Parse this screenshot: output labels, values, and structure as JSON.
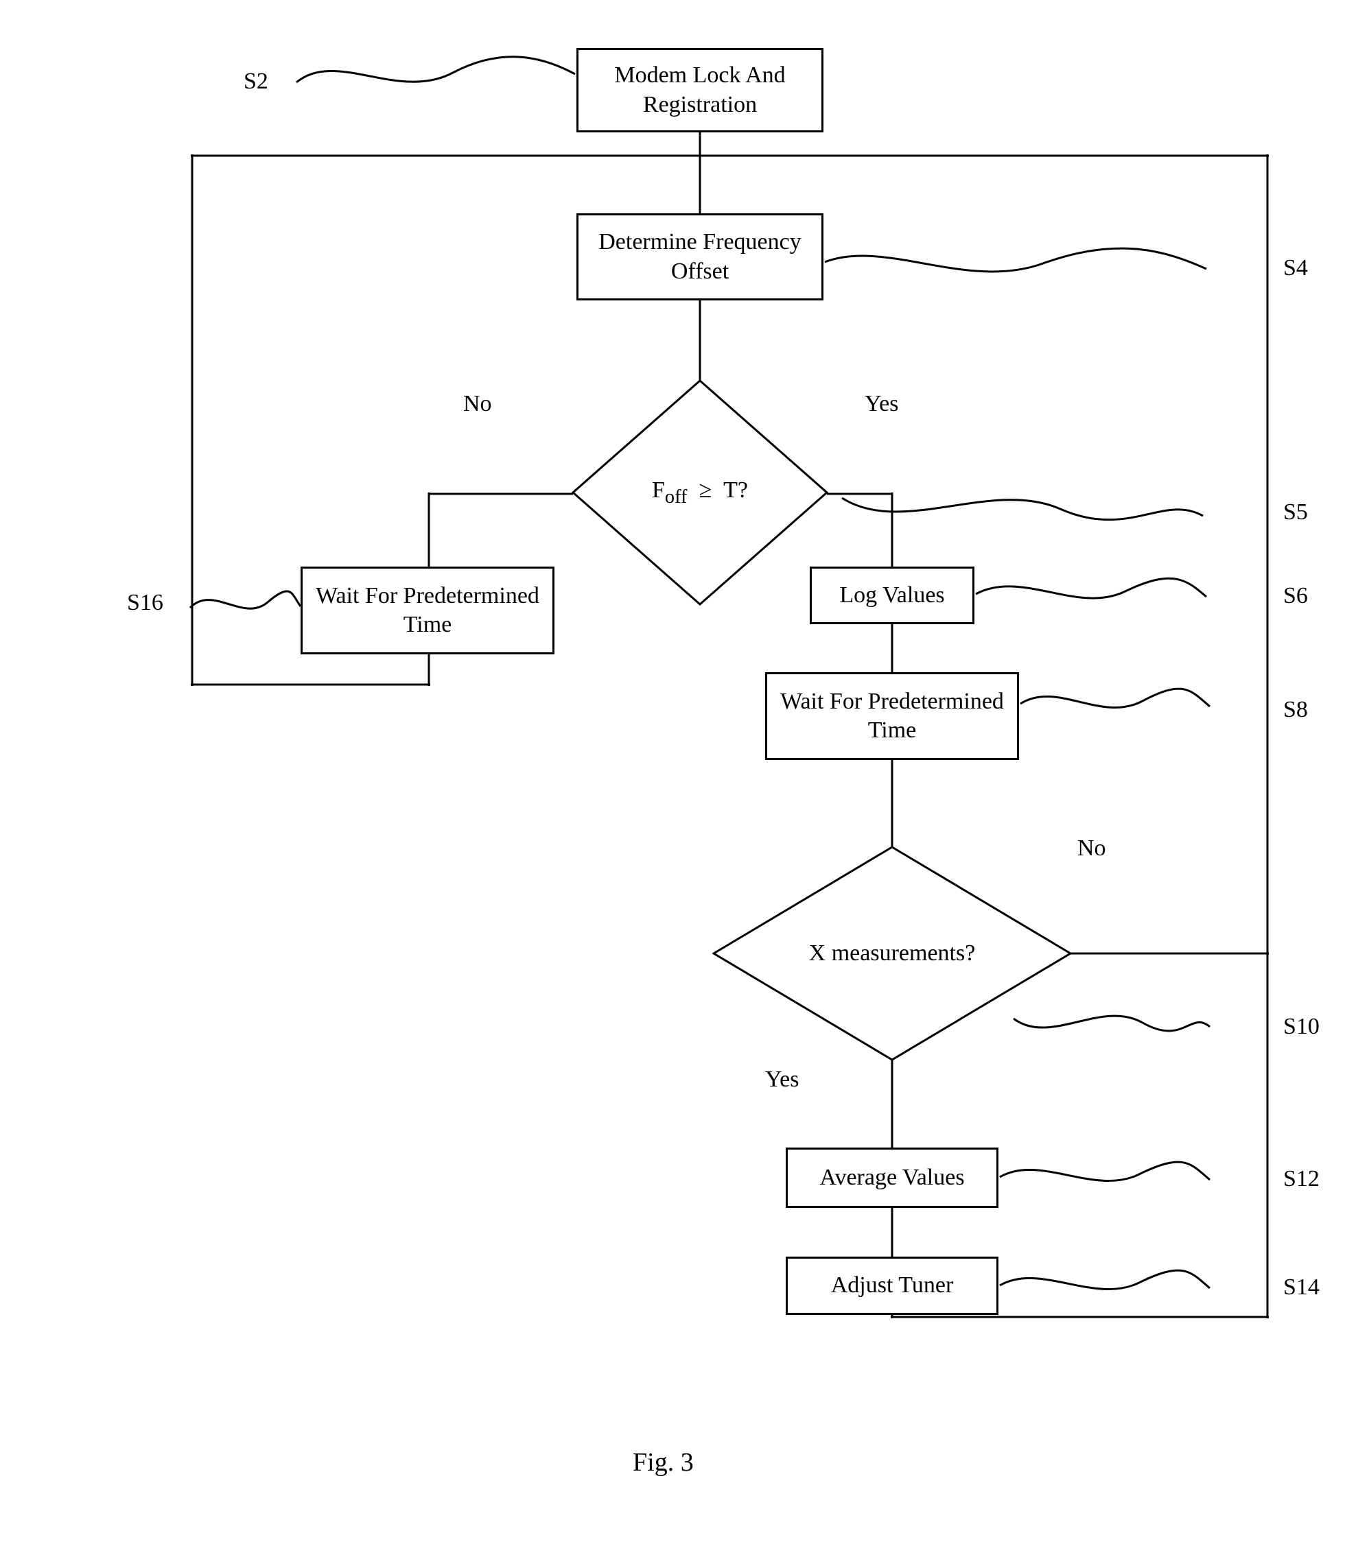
{
  "figure_caption": "Fig. 3",
  "nodes": {
    "s2": {
      "text": "Modem Lock And Registration",
      "tag": "S2"
    },
    "s4": {
      "text": "Determine Frequency Offset",
      "tag": "S4"
    },
    "s5": {
      "text": "Foff  ≥  T?",
      "tag": "S5",
      "yes": "Yes",
      "no": "No"
    },
    "s6": {
      "text": "Log Values",
      "tag": "S6"
    },
    "s8": {
      "text": "Wait For Predetermined Time",
      "tag": "S8"
    },
    "s10": {
      "text": "X measurements?",
      "tag": "S10",
      "yes": "Yes",
      "no": "No"
    },
    "s12": {
      "text": "Average Values",
      "tag": "S12"
    },
    "s14": {
      "text": "Adjust Tuner",
      "tag": "S14"
    },
    "s16": {
      "text": "Wait For Predetermined Time",
      "tag": "S16"
    }
  }
}
